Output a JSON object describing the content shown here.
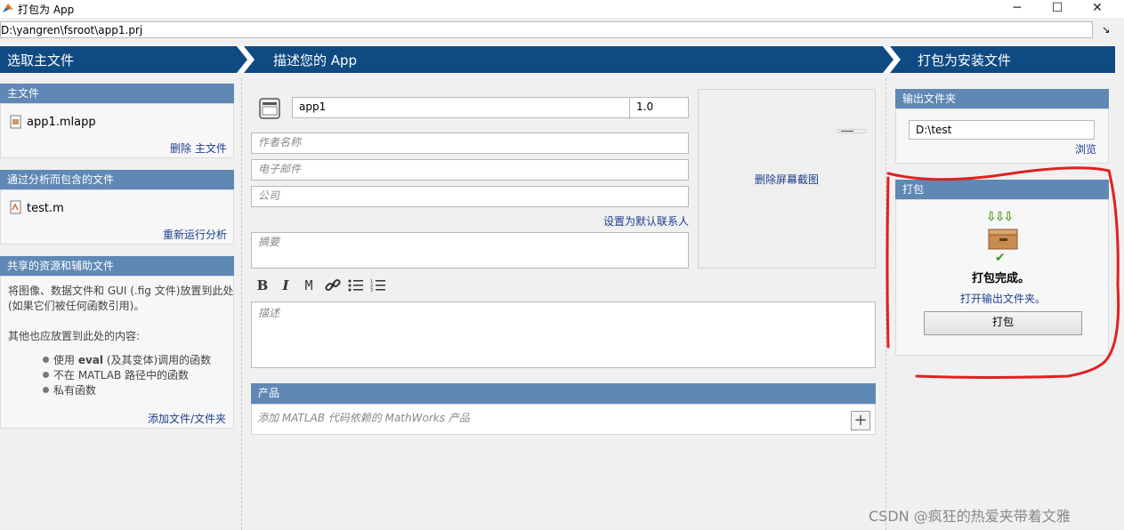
{
  "window": {
    "title": "打包为 App",
    "minimize": "─",
    "maximize": "☐",
    "close": "✕"
  },
  "path": {
    "value": "D:\\yangren\\fsroot\\app1.prj",
    "arrow": "↘"
  },
  "stages": [
    "选取主文件",
    "描述您的 App",
    "打包为安装文件"
  ],
  "left": {
    "main_file": {
      "header": "主文件",
      "file": "app1.mlapp",
      "action": "删除 主文件"
    },
    "analysis": {
      "header": "通过分析而包含的文件",
      "file": "test.m",
      "action": "重新运行分析"
    },
    "shared": {
      "header": "共享的资源和辅助文件",
      "desc_line1": "将图像、数据文件和 GUI (.fig 文件)放置到此处",
      "desc_line2": "(如果它们被任何函数引用)。",
      "also_line": "其他也应放置到此处的内容:",
      "items": [
        {
          "pre": "使用 ",
          "bold": "eval",
          "post": " (及其变体)调用的函数"
        },
        {
          "pre": "不在 MATLAB 路径中的函数",
          "bold": "",
          "post": ""
        },
        {
          "pre": "私有函数",
          "bold": "",
          "post": ""
        }
      ],
      "action": "添加文件/文件夹"
    }
  },
  "middle": {
    "app_name": "app1",
    "version": "1.0",
    "author_placeholder": "作者名称",
    "email_placeholder": "电子邮件",
    "company_placeholder": "公司",
    "default_contact_link": "设置为默认联系人",
    "summary_placeholder": "摘要",
    "delete_screenshot": "删除屏幕截图",
    "toolbar": {
      "bold": "B",
      "italic": "I",
      "mono": "M",
      "link": "🔗",
      "bullets": "☰",
      "numbered": "☰"
    },
    "description_placeholder": "描述",
    "products": {
      "header": "产品",
      "placeholder": "添加 MATLAB 代码依赖的 MathWorks 产品",
      "add": "+"
    }
  },
  "right": {
    "output": {
      "header": "输出文件夹",
      "value": "D:\\test",
      "browse": "浏览"
    },
    "package": {
      "header": "打包",
      "status": "打包完成。",
      "open_folder": "打开输出文件夹。",
      "button": "打包",
      "arrows": "⇩⇩⇩",
      "check": "✔"
    }
  },
  "watermark": "CSDN @疯狂的热爱夹带着文雅",
  "colors": {
    "banner": "#0f4a82",
    "section_header": "#5f88b5",
    "annotation": "#e02020",
    "link": "#1c3f8f"
  }
}
